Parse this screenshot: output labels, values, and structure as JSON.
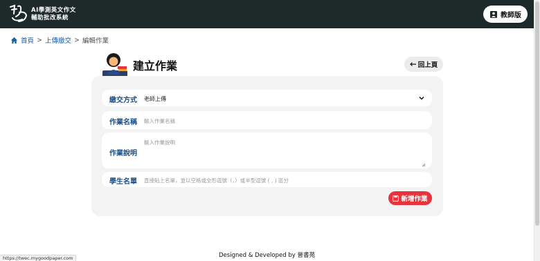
{
  "topbar": {
    "logo_line1": "AI學測英文作文",
    "logo_line2": "輔助批改系統",
    "teacher_button": "教師版"
  },
  "breadcrumb": {
    "home": "首頁",
    "sep1": ">",
    "upload": "上傳繳交",
    "sep2": ">",
    "current": "編輯作業"
  },
  "page": {
    "title": "建立作業",
    "back_button": "回上頁"
  },
  "form": {
    "submit_method": {
      "label": "繳交方式",
      "value": "老師上傳"
    },
    "assignment_name": {
      "label": "作業名稱",
      "placeholder": "輸入作業名稱"
    },
    "assignment_desc": {
      "label": "作業說明",
      "placeholder": "輸入作業說明"
    },
    "student_list": {
      "label": "學生名單",
      "placeholder": "直接貼上名單，並以空格或全形逗號（，）或半型逗號 ( , ) 區分"
    },
    "add_button": "新增作業"
  },
  "footer": {
    "text": "Designed & Developed by 晉書苑"
  },
  "status_url": "https://twec.mygoodpaper.com",
  "colors": {
    "topbar": "#1e2a29",
    "accent_blue": "#1b4f87",
    "add_button": "#e8323c"
  },
  "icons": [
    "logo-mark",
    "teacher-book-icon",
    "home-icon",
    "back-arrow-icon",
    "chevron-down-icon",
    "resize-grip-icon",
    "save-icon",
    "teacher-avatar"
  ]
}
